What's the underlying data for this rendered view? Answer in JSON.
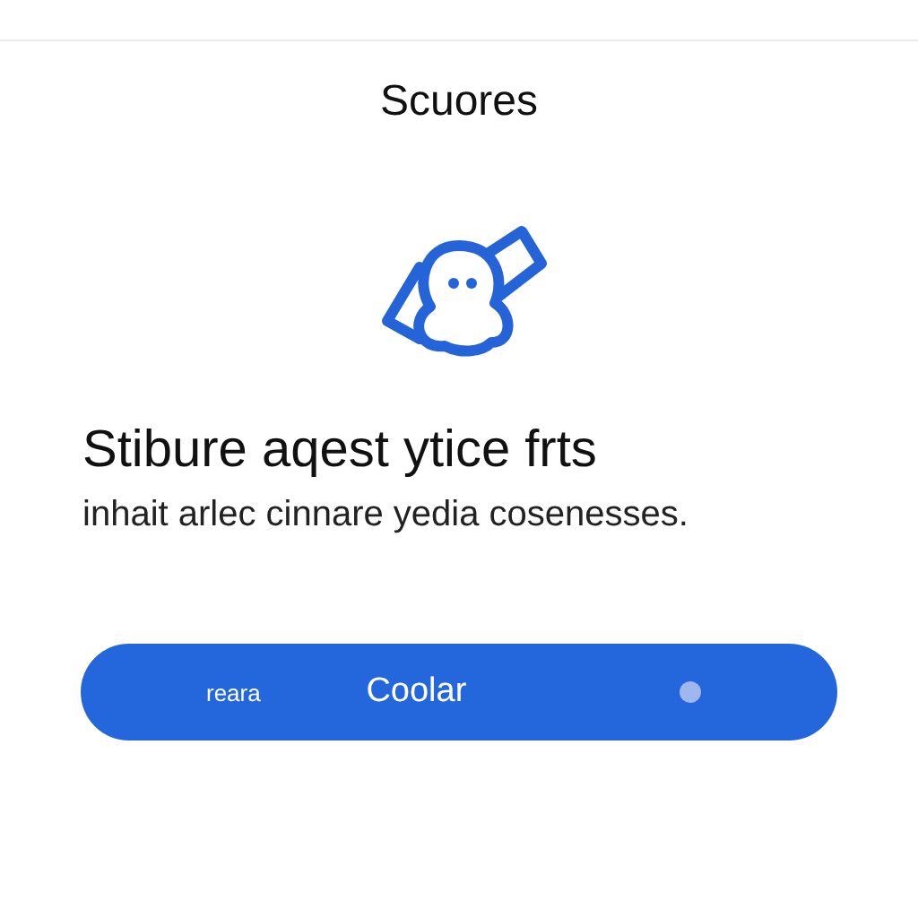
{
  "header": {
    "title": "Scuores"
  },
  "heading": "Stibure aqest ytice frts",
  "description": "inhait arlec cinnare yedia cosenesses.",
  "action_bar": {
    "left_label": "reara",
    "label": "Coolar"
  }
}
